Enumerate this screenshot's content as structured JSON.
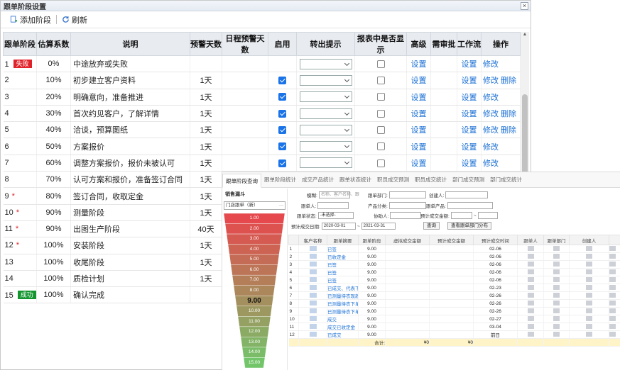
{
  "window": {
    "title": "跟单阶段设置",
    "close_glyph": "×"
  },
  "toolbar": {
    "add_label": "添加阶段",
    "refresh_label": "刷新"
  },
  "table": {
    "headers": [
      "跟单阶段",
      "估算系数",
      "说明",
      "预警天数",
      "日程预警天数",
      "启用",
      "转出提示",
      "报表中是否显示",
      "高级",
      "需审批",
      "工作流",
      "操作"
    ],
    "rows": [
      {
        "stage": "1",
        "badge": "失败",
        "badge_type": "fail",
        "coef": "0%",
        "desc": "中途放弃或失败",
        "days": "",
        "enabled": null,
        "select": true,
        "report": true,
        "adv": "设置",
        "wf": "设置",
        "ops": [
          "修改"
        ]
      },
      {
        "stage": "2",
        "coef": "10%",
        "desc": "初步建立客户资料",
        "days": "1天",
        "enabled": true,
        "select": true,
        "report": true,
        "adv": "设置",
        "wf": "设置",
        "ops": [
          "修改",
          "删除"
        ]
      },
      {
        "stage": "3",
        "coef": "20%",
        "desc": "明确意向，准备推进",
        "days": "1天",
        "enabled": true,
        "select": true,
        "report": true,
        "adv": "设置",
        "wf": "设置",
        "ops": [
          "修改"
        ]
      },
      {
        "stage": "4",
        "coef": "30%",
        "desc": "首次约见客户，了解详情",
        "days": "1天",
        "enabled": true,
        "select": true,
        "report": true,
        "adv": "设置",
        "wf": "设置",
        "ops": [
          "修改",
          "删除"
        ]
      },
      {
        "stage": "5",
        "coef": "40%",
        "desc": "洽谈，预算图纸",
        "days": "1天",
        "enabled": true,
        "select": true,
        "report": true,
        "adv": "设置",
        "wf": "设置",
        "ops": [
          "修改",
          "删除"
        ]
      },
      {
        "stage": "6",
        "coef": "50%",
        "desc": "方案报价",
        "days": "1天",
        "enabled": true,
        "select": true,
        "report": true,
        "adv": "设置",
        "wf": "设置",
        "ops": [
          "修改"
        ]
      },
      {
        "stage": "7",
        "coef": "60%",
        "desc": "调整方案报价，报价未被认可",
        "days": "1天",
        "enabled": true,
        "select": true,
        "report": true,
        "adv": "设置",
        "wf": "设置",
        "ops": [
          "修改"
        ]
      },
      {
        "stage": "8",
        "coef": "70%",
        "desc": "认可方案和报价，准备签订合同",
        "days": "1天",
        "enabled": null,
        "select": false,
        "report": false,
        "adv": "",
        "wf": "",
        "ops": []
      },
      {
        "stage": "9",
        "star": true,
        "coef": "80%",
        "desc": "签订合同，收取定金",
        "days": "1天",
        "enabled": null,
        "select": false,
        "report": false,
        "adv": "",
        "wf": "",
        "ops": []
      },
      {
        "stage": "10",
        "star": true,
        "coef": "90%",
        "desc": "测量阶段",
        "days": "1天",
        "enabled": null,
        "select": false,
        "report": false,
        "adv": "",
        "wf": "",
        "ops": []
      },
      {
        "stage": "11",
        "star": true,
        "coef": "90%",
        "desc": "出图生产阶段",
        "days": "40天",
        "enabled": null,
        "select": false,
        "report": false,
        "adv": "",
        "wf": "",
        "ops": []
      },
      {
        "stage": "12",
        "star": true,
        "coef": "100%",
        "desc": "安装阶段",
        "days": "1天",
        "enabled": null,
        "select": false,
        "report": false,
        "adv": "",
        "wf": "",
        "ops": []
      },
      {
        "stage": "13",
        "coef": "100%",
        "desc": "收尾阶段",
        "days": "1天",
        "enabled": null,
        "select": false,
        "report": false,
        "adv": "",
        "wf": "",
        "ops": []
      },
      {
        "stage": "14",
        "coef": "100%",
        "desc": "质检计划",
        "days": "1天",
        "enabled": null,
        "select": false,
        "report": false,
        "adv": "",
        "wf": "",
        "ops": []
      },
      {
        "stage": "15",
        "badge": "成功",
        "badge_type": "ok",
        "coef": "100%",
        "desc": "确认完成",
        "days": "",
        "enabled": null,
        "select": false,
        "report": false,
        "adv": "",
        "wf": "",
        "ops": []
      }
    ]
  },
  "overlay": {
    "tabs": [
      "跟单阶段查询",
      "跟单阶段统计",
      "成交产品统计",
      "跟单状态统计",
      "职员成交预测",
      "职员成交统计",
      "部门成交预测",
      "部门成交统计"
    ],
    "funnel_title": "销售漏斗",
    "funnel_select": "门店跟单（新）",
    "funnel_values": [
      "1.00",
      "2.00",
      "3.00",
      "4.00",
      "5.00",
      "6.00",
      "7.00",
      "8.00",
      "9.00",
      "10.00",
      "11.00",
      "12.00",
      "13.00",
      "14.00",
      "15.00"
    ],
    "funnel_highlight": "9.00",
    "filters": {
      "row1": [
        "模糊:",
        "跟单部门:",
        "创建人:"
      ],
      "row1_placeholder": "名称、客户名称、跟",
      "row2": [
        "跟单人:",
        "产品分类:",
        "跟单产品:"
      ],
      "row3": [
        "跟单状态:",
        "协助人:",
        "预计成交金额:"
      ],
      "status_value": "-未选择-",
      "date_label": "预计成交日期:",
      "date_from": "2020-03-01",
      "date_to": "2021-03-31",
      "search_btn": "查询",
      "dist_btn": "查看跟单部门分布"
    },
    "table_headers": [
      "",
      "客户名称",
      "跟单摘要",
      "跟单阶段",
      "虚拟成交金额",
      "预计成交金额",
      "预计成交时间",
      "跟单人",
      "跟单部门",
      "创建人",
      ""
    ],
    "rows": [
      {
        "n": "1",
        "summary": "已签",
        "stage": "9.00",
        "date": "02-06"
      },
      {
        "n": "2",
        "summary": "已收定金",
        "stage": "9.00",
        "date": "02-06"
      },
      {
        "n": "3",
        "summary": "已签",
        "stage": "9.00",
        "date": "02-06"
      },
      {
        "n": "4",
        "summary": "已签",
        "stage": "9.00",
        "date": "02-06"
      },
      {
        "n": "5",
        "summary": "已签",
        "stage": "9.00",
        "date": "02-06"
      },
      {
        "n": "6",
        "summary": "已成交、代表下",
        "stage": "9.00",
        "date": "02-23"
      },
      {
        "n": "7",
        "summary": "已测量待衣现款",
        "stage": "9.00",
        "date": "02-26"
      },
      {
        "n": "8",
        "summary": "已测量待衣下单",
        "stage": "9.00",
        "date": "02-26"
      },
      {
        "n": "9",
        "summary": "已测量待衣下单",
        "stage": "9.00",
        "date": "02-26"
      },
      {
        "n": "10",
        "summary": "成交",
        "stage": "9.00",
        "date": "02-27"
      },
      {
        "n": "11",
        "summary": "成交已收定金",
        "stage": "9.00",
        "date": "03-04"
      },
      {
        "n": "12",
        "summary": "已成交",
        "stage": "9.00",
        "date": "前日"
      }
    ],
    "total": {
      "label": "合计:",
      "v1": "¥0",
      "v2": "¥0"
    }
  },
  "colors": {
    "fail": "#e0232a",
    "ok": "#13962f",
    "link": "#1a6fd4",
    "funnel_top": "#e5484d",
    "funnel_bottom": "#73c56a"
  }
}
